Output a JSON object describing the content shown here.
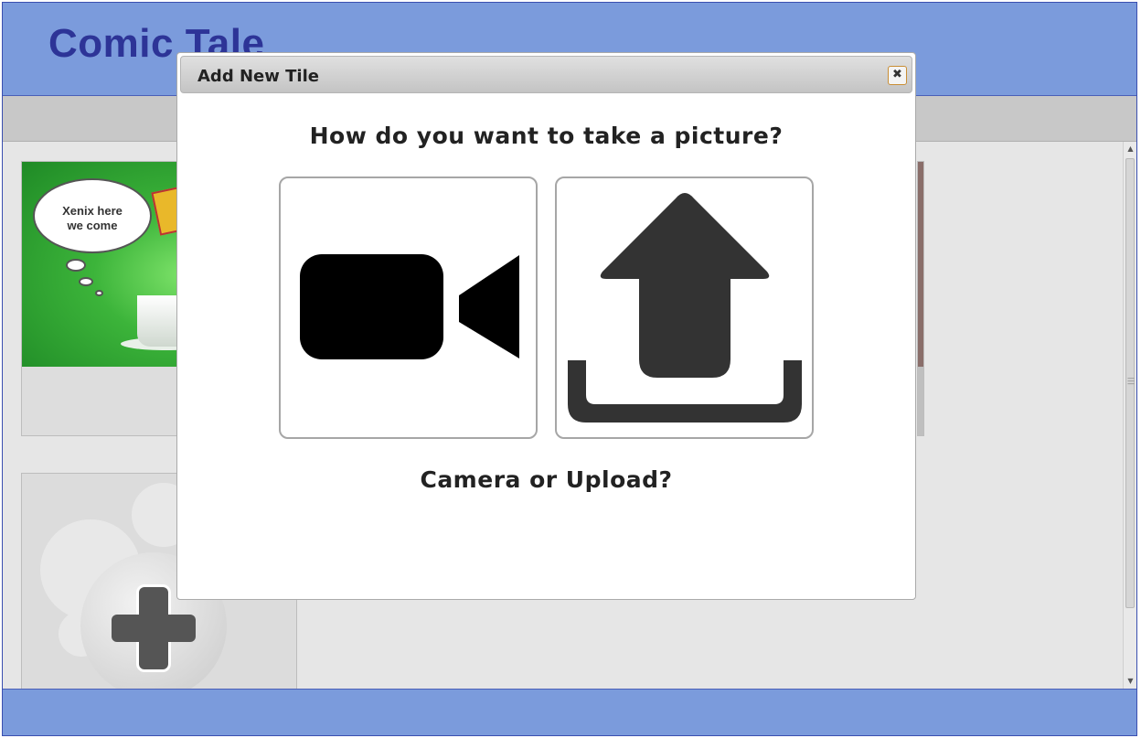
{
  "app": {
    "title": "Comic Tale"
  },
  "tiles": [
    {
      "bubble_text": "Xenix here we come",
      "bubble_line1": "Xenix here",
      "bubble_line2": "we come"
    }
  ],
  "dialog": {
    "title": "Add New Tile",
    "close_icon": "close-icon",
    "question": "How do you want to take a picture?",
    "options": [
      {
        "name": "camera",
        "icon": "video-camera-icon"
      },
      {
        "name": "upload",
        "icon": "upload-icon"
      }
    ],
    "prompt": "Camera or Upload?"
  },
  "colors": {
    "header": "#7b9bdc",
    "title": "#2d3497",
    "accent_border": "#c98e35"
  }
}
